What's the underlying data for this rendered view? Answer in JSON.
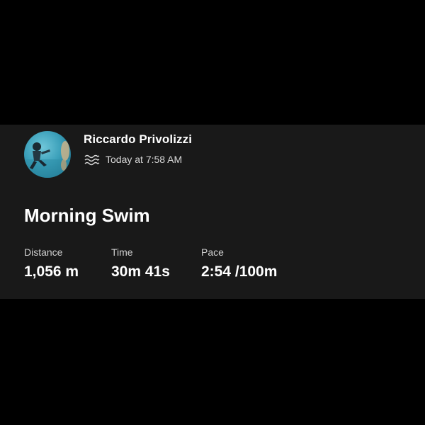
{
  "activity": {
    "athlete_name": "Riccardo Privolizzi",
    "sport_icon": "swim-waves-icon",
    "timestamp": "Today at 7:58 AM",
    "title": "Morning Swim",
    "stats": {
      "distance": {
        "label": "Distance",
        "value": "1,056 m"
      },
      "time": {
        "label": "Time",
        "value": "30m 41s"
      },
      "pace": {
        "label": "Pace",
        "value": "2:54 /100m"
      }
    }
  },
  "colors": {
    "background": "#000000",
    "card": "#191919",
    "primary_text": "#ffffff",
    "secondary_text": "#d0d0d0"
  }
}
